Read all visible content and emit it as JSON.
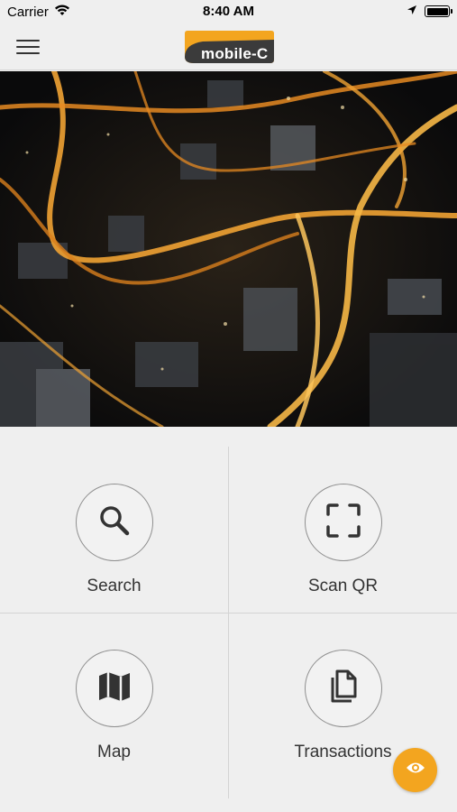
{
  "status_bar": {
    "carrier": "Carrier",
    "time": "8:40 AM"
  },
  "header": {
    "logo_text": "mobile-C",
    "brand_color": "#f3a51f"
  },
  "tiles": [
    {
      "label": "Search",
      "icon": "search-icon"
    },
    {
      "label": "Scan QR",
      "icon": "scan-qr-icon"
    },
    {
      "label": "Map",
      "icon": "map-icon"
    },
    {
      "label": "Transactions",
      "icon": "documents-icon"
    }
  ],
  "fab": {
    "icon": "eye-icon",
    "color": "#f3a51f"
  }
}
